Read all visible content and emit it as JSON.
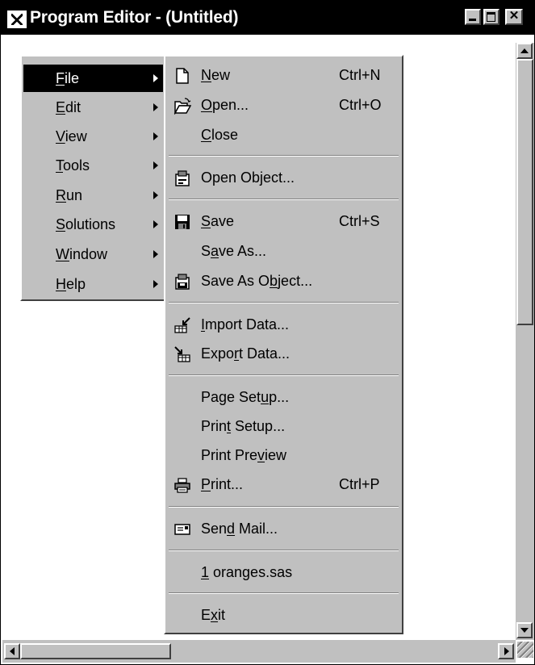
{
  "window": {
    "title": "Program Editor - (Untitled)"
  },
  "menu": {
    "items": [
      {
        "pre": "",
        "key": "F",
        "post": "ile"
      },
      {
        "pre": "",
        "key": "E",
        "post": "dit"
      },
      {
        "pre": "",
        "key": "V",
        "post": "iew"
      },
      {
        "pre": "",
        "key": "T",
        "post": "ools"
      },
      {
        "pre": "",
        "key": "R",
        "post": "un"
      },
      {
        "pre": "",
        "key": "S",
        "post": "olutions"
      },
      {
        "pre": "",
        "key": "W",
        "post": "indow"
      },
      {
        "pre": "",
        "key": "H",
        "post": "elp"
      }
    ],
    "active": "File"
  },
  "file_menu": {
    "new": {
      "pre": "",
      "key": "N",
      "post": "ew",
      "shortcut": "Ctrl+N"
    },
    "open": {
      "pre": "",
      "key": "O",
      "post": "pen...",
      "shortcut": "Ctrl+O"
    },
    "close": {
      "pre": "",
      "key": "C",
      "post": "lose"
    },
    "open_object": {
      "label": "Open Object..."
    },
    "save": {
      "pre": "",
      "key": "S",
      "post": "ave",
      "shortcut": "Ctrl+S"
    },
    "save_as": {
      "pre": "S",
      "key": "a",
      "post": "ve As..."
    },
    "save_as_object": {
      "pre": "Save As O",
      "key": "b",
      "post": "ject..."
    },
    "import_data": {
      "pre": "",
      "key": "I",
      "post": "mport Data..."
    },
    "export_data": {
      "pre": "Expo",
      "key": "r",
      "post": "t Data..."
    },
    "page_setup": {
      "pre": "Page Set",
      "key": "u",
      "post": "p..."
    },
    "print_setup": {
      "pre": "Prin",
      "key": "t",
      "post": " Setup..."
    },
    "print_preview": {
      "pre": "Print Pre",
      "key": "v",
      "post": "iew"
    },
    "print": {
      "pre": "",
      "key": "P",
      "post": "rint...",
      "shortcut": "Ctrl+P"
    },
    "send_mail": {
      "pre": "Sen",
      "key": "d",
      "post": " Mail..."
    },
    "recent": {
      "pre": "",
      "key": "1",
      "post": " oranges.sas"
    },
    "exit": {
      "pre": "E",
      "key": "x",
      "post": "it"
    }
  },
  "icons": {
    "app": "program-editor-icon",
    "new": "new-document-icon",
    "open": "open-folder-icon",
    "open_object": "open-object-icon",
    "save": "floppy-disk-icon",
    "save_as_object": "save-object-icon",
    "import_data": "import-data-icon",
    "export_data": "export-data-icon",
    "print": "printer-icon",
    "send_mail": "mail-icon"
  },
  "colors": {
    "titlebar": "#000000",
    "menu_face": "#c0c0c0",
    "highlight": "#000000",
    "highlight_text": "#ffffff"
  }
}
